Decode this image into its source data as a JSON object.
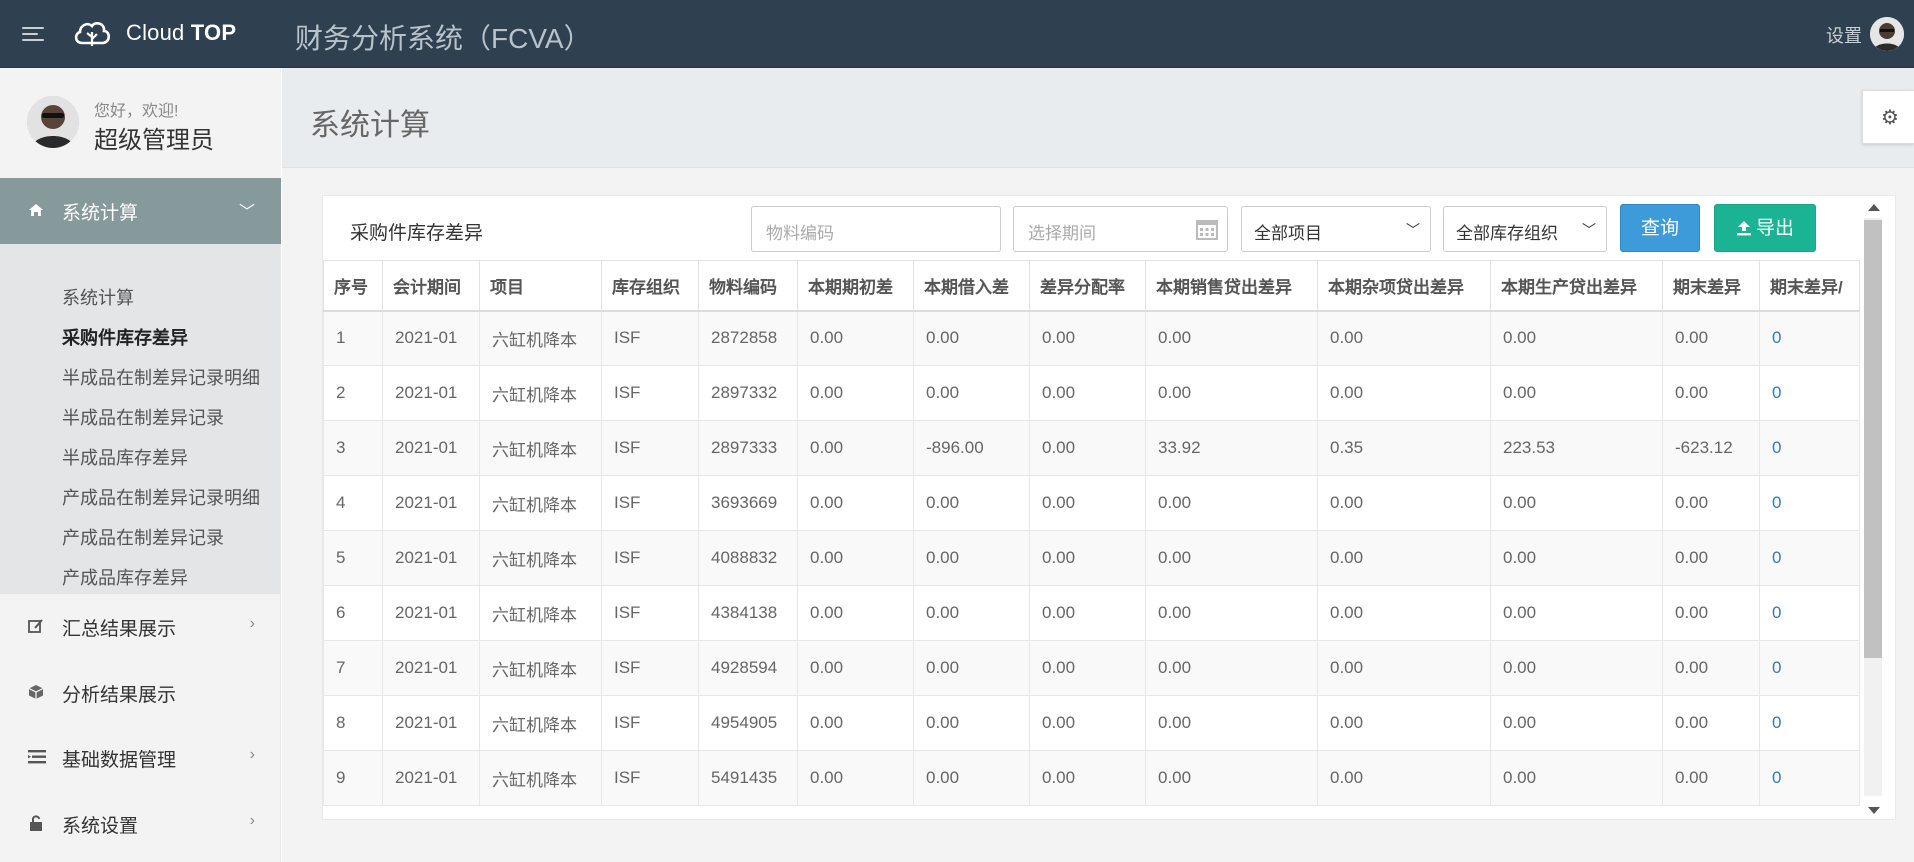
{
  "header": {
    "brand_light": "Cloud",
    "brand_bold": "TOP",
    "system_title": "财务分析系统（FCVA）",
    "settings_label": "设置"
  },
  "sidebar": {
    "greeting": "您好，欢迎!",
    "username": "超级管理员",
    "active_section": "系统计算",
    "submenu": [
      "系统计算",
      "采购件库存差异",
      "半成品在制差异记录明细",
      "半成品在制差异记录",
      "半成品库存差异",
      "产成品在制差异记录明细",
      "产成品在制差异记录",
      "产成品库存差异"
    ],
    "items": [
      {
        "label": "汇总结果展示",
        "icon": "edit-icon"
      },
      {
        "label": "分析结果展示",
        "icon": "cube-icon"
      },
      {
        "label": "基础数据管理",
        "icon": "list-icon"
      },
      {
        "label": "系统设置",
        "icon": "lock-icon"
      }
    ]
  },
  "main": {
    "page_title": "系统计算",
    "panel_title": "采购件库存差异",
    "material_placeholder": "物料编码",
    "period_placeholder": "选择期间",
    "project_select": "全部项目",
    "org_select": "全部库存组织",
    "query_button": "查询",
    "export_button": "导出",
    "columns": [
      "序号",
      "会计期间",
      "项目",
      "库存组织",
      "物料编码",
      "本期期初差",
      "本期借入差",
      "差异分配率",
      "本期销售贷出差异",
      "本期杂项贷出差异",
      "本期生产贷出差异",
      "期末差异",
      "期末差异/"
    ],
    "rows": [
      [
        "1",
        "2021-01",
        "六缸机降本",
        "ISF",
        "2872858",
        "0.00",
        "0.00",
        "0.00",
        "0.00",
        "0.00",
        "0.00",
        "0.00",
        "0"
      ],
      [
        "2",
        "2021-01",
        "六缸机降本",
        "ISF",
        "2897332",
        "0.00",
        "0.00",
        "0.00",
        "0.00",
        "0.00",
        "0.00",
        "0.00",
        "0"
      ],
      [
        "3",
        "2021-01",
        "六缸机降本",
        "ISF",
        "2897333",
        "0.00",
        "-896.00",
        "0.00",
        "33.92",
        "0.35",
        "223.53",
        "-623.12",
        "0"
      ],
      [
        "4",
        "2021-01",
        "六缸机降本",
        "ISF",
        "3693669",
        "0.00",
        "0.00",
        "0.00",
        "0.00",
        "0.00",
        "0.00",
        "0.00",
        "0"
      ],
      [
        "5",
        "2021-01",
        "六缸机降本",
        "ISF",
        "4088832",
        "0.00",
        "0.00",
        "0.00",
        "0.00",
        "0.00",
        "0.00",
        "0.00",
        "0"
      ],
      [
        "6",
        "2021-01",
        "六缸机降本",
        "ISF",
        "4384138",
        "0.00",
        "0.00",
        "0.00",
        "0.00",
        "0.00",
        "0.00",
        "0.00",
        "0"
      ],
      [
        "7",
        "2021-01",
        "六缸机降本",
        "ISF",
        "4928594",
        "0.00",
        "0.00",
        "0.00",
        "0.00",
        "0.00",
        "0.00",
        "0.00",
        "0"
      ],
      [
        "8",
        "2021-01",
        "六缸机降本",
        "ISF",
        "4954905",
        "0.00",
        "0.00",
        "0.00",
        "0.00",
        "0.00",
        "0.00",
        "0.00",
        "0"
      ],
      [
        "9",
        "2021-01",
        "六缸机降本",
        "ISF",
        "5491435",
        "0.00",
        "0.00",
        "0.00",
        "0.00",
        "0.00",
        "0.00",
        "0.00",
        "0"
      ]
    ]
  },
  "colors": {
    "topbar": "#2f4050",
    "nav_active": "#879a9b",
    "query": "#3c9bd8",
    "export": "#1ab394"
  }
}
